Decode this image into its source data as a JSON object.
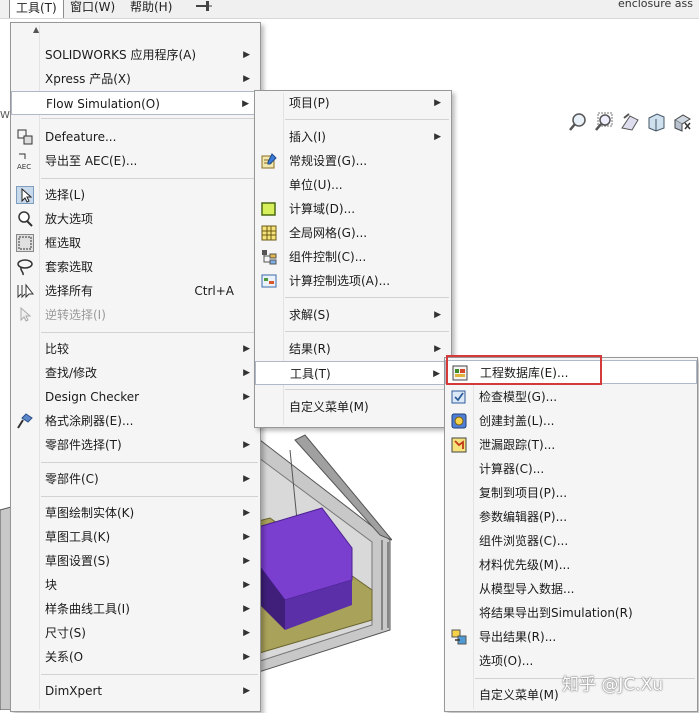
{
  "menubar": {
    "items": [
      {
        "label": "工具(T)"
      },
      {
        "label": "窗口(W)"
      },
      {
        "label": "帮助(H)"
      }
    ],
    "pin_icon": "pin-icon",
    "window_title": "enclosure ass"
  },
  "left_tab_text": "W",
  "menu_tools": {
    "scroll_up": "▲",
    "items": [
      {
        "label": "SOLIDWORKS 应用程序(A)",
        "submenu": true
      },
      {
        "label": "Xpress 产品(X)",
        "submenu": true
      },
      {
        "label": "Flow Simulation(O)",
        "submenu": true,
        "highlighted": true
      },
      {
        "label": "Defeature...",
        "icon": "defeature-icon"
      },
      {
        "label": "导出至 AEC(E)...",
        "icon": "aec-export-icon"
      },
      {
        "label": "选择(L)",
        "icon": "select-arrow-icon"
      },
      {
        "label": "放大选项",
        "icon": "magnify-select-icon"
      },
      {
        "label": "框选取",
        "icon": "box-select-icon"
      },
      {
        "label": "套索选取",
        "icon": "lasso-select-icon"
      },
      {
        "label": "选择所有",
        "icon": "select-all-icon",
        "shortcut": "Ctrl+A"
      },
      {
        "label": "逆转选择(I)",
        "icon": "invert-select-icon",
        "disabled": true
      },
      {
        "label": "比较",
        "submenu": true
      },
      {
        "label": "查找/修改",
        "submenu": true
      },
      {
        "label": "Design Checker",
        "submenu": true
      },
      {
        "label": "格式涂刷器(E)...",
        "icon": "format-painter-icon"
      },
      {
        "label": "零部件选择(T)",
        "submenu": true
      },
      {
        "label": "零部件(C)",
        "submenu": true
      },
      {
        "label": "草图绘制实体(K)",
        "submenu": true
      },
      {
        "label": "草图工具(K)",
        "submenu": true
      },
      {
        "label": "草图设置(S)",
        "submenu": true
      },
      {
        "label": "块",
        "submenu": true
      },
      {
        "label": "样条曲线工具(I)",
        "submenu": true
      },
      {
        "label": "尺寸(S)",
        "submenu": true
      },
      {
        "label": "关系(O",
        "submenu": true
      },
      {
        "label": "DimXpert",
        "submenu": true
      }
    ]
  },
  "menu_flow": {
    "items": [
      {
        "label": "项目(P)",
        "submenu": true
      },
      {
        "label": "插入(I)",
        "submenu": true
      },
      {
        "label": "常规设置(G)...",
        "icon": "general-settings-icon"
      },
      {
        "label": "单位(U)..."
      },
      {
        "label": "计算域(D)...",
        "icon": "computational-domain-icon"
      },
      {
        "label": "全局网格(G)...",
        "icon": "global-mesh-icon"
      },
      {
        "label": "组件控制(C)...",
        "icon": "component-control-icon"
      },
      {
        "label": "计算控制选项(A)...",
        "icon": "calculation-control-icon"
      },
      {
        "label": "求解(S)",
        "submenu": true
      },
      {
        "label": "结果(R)",
        "submenu": true
      },
      {
        "label": "工具(T)",
        "submenu": true,
        "highlighted": true
      },
      {
        "label": "自定义菜单(M)"
      }
    ]
  },
  "menu_flow_tools": {
    "items": [
      {
        "label": "工程数据库(E)...",
        "icon": "engineering-database-icon",
        "highlighted": true
      },
      {
        "label": "检查模型(G)...",
        "icon": "check-geometry-icon"
      },
      {
        "label": "创建封盖(L)...",
        "icon": "create-lids-icon"
      },
      {
        "label": "泄漏跟踪(T)...",
        "icon": "leak-tracking-icon"
      },
      {
        "label": "计算器(C)..."
      },
      {
        "label": "复制到项目(P)..."
      },
      {
        "label": "参数编辑器(P)..."
      },
      {
        "label": "组件浏览器(C)..."
      },
      {
        "label": "材料优先级(M)..."
      },
      {
        "label": "从模型导入数据..."
      },
      {
        "label": "将结果导出到Simulation(R)"
      },
      {
        "label": "导出结果(R)...",
        "icon": "export-results-icon"
      },
      {
        "label": "选项(O)..."
      },
      {
        "label": "自定义菜单(M)"
      }
    ]
  },
  "watermark": "知乎 @JC.Xu",
  "colors": {
    "menu_bg": "#f5f5f5",
    "highlight_border": "#aeb8c6",
    "red_annotation": "#d43a3a",
    "model_purple": "#7b3fd0",
    "model_olive": "#a9a25a"
  }
}
